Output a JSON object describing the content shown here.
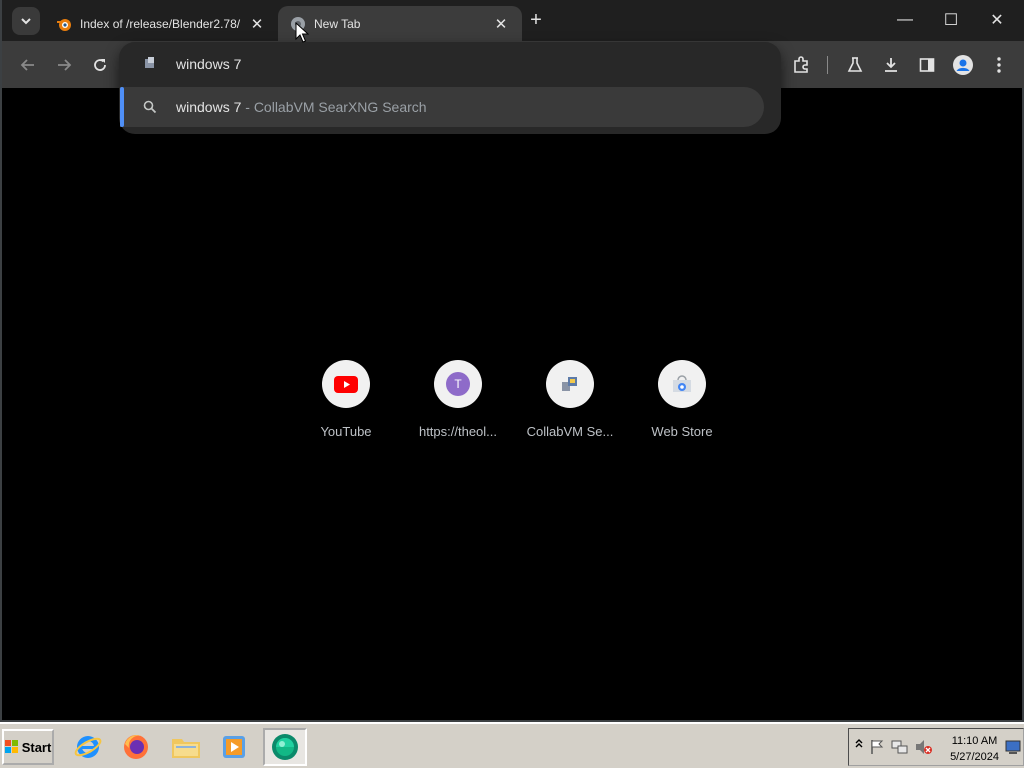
{
  "tabs": [
    {
      "title": "Index of /release/Blender2.78/",
      "close": "✕",
      "favicon": "blender-icon"
    },
    {
      "title": "New Tab",
      "close": "✕",
      "favicon": "globe-icon"
    }
  ],
  "new_tab": "+",
  "window_controls": {
    "minimize": "—",
    "maximize": "☐",
    "close": "✕"
  },
  "omnibox": {
    "query": "windows 7",
    "suggestion": {
      "query": "windows 7",
      "provider": " - CollabVM SearXNG Search"
    }
  },
  "shortcuts": [
    {
      "label": "YouTube",
      "icon": "youtube-icon"
    },
    {
      "label": "https://theol...",
      "icon": "letter-t-icon",
      "letter": "T"
    },
    {
      "label": "CollabVM Se...",
      "icon": "collabvm-icon"
    },
    {
      "label": "Web Store",
      "icon": "webstore-icon"
    }
  ],
  "taskbar": {
    "start_label": "Start",
    "clock_time": "11:10 AM",
    "clock_date": "5/27/2024"
  },
  "colors": {
    "accent": "#4f8ff7",
    "youtube_red": "#ff0000",
    "avatar_purple": "#8e6bc9"
  }
}
